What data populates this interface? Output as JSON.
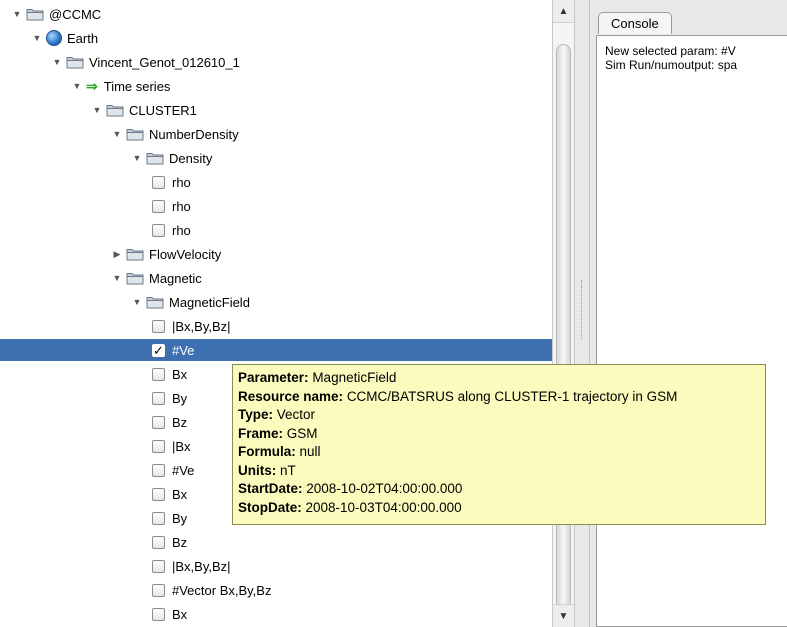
{
  "tree": {
    "rows": [
      {
        "label": "@CCMC",
        "indent": 0,
        "toggle": "expanded",
        "icon": "folder-icon"
      },
      {
        "label": "Earth",
        "indent": 1,
        "toggle": "expanded",
        "icon": "globe-icon"
      },
      {
        "label": "Vincent_Genot_012610_1",
        "indent": 2,
        "toggle": "expanded",
        "icon": "folder-icon"
      },
      {
        "label": "Time series",
        "indent": 3,
        "toggle": "expanded",
        "icon": "arrow-right-icon"
      },
      {
        "label": "CLUSTER1",
        "indent": 4,
        "toggle": "expanded",
        "icon": "folder-icon"
      },
      {
        "label": "NumberDensity",
        "indent": 5,
        "toggle": "expanded",
        "icon": "folder-icon"
      },
      {
        "label": "Density",
        "indent": 6,
        "toggle": "expanded",
        "icon": "folder-icon"
      },
      {
        "label": "rho",
        "indent": 7,
        "icon": "checkbox",
        "checked": false
      },
      {
        "label": "rho",
        "indent": 7,
        "icon": "checkbox",
        "checked": false
      },
      {
        "label": "rho",
        "indent": 7,
        "icon": "checkbox",
        "checked": false
      },
      {
        "label": "FlowVelocity",
        "indent": 5,
        "toggle": "collapsed",
        "icon": "folder-icon"
      },
      {
        "label": "Magnetic",
        "indent": 5,
        "toggle": "expanded",
        "icon": "folder-icon"
      },
      {
        "label": "MagneticField",
        "indent": 6,
        "toggle": "expanded",
        "icon": "folder-icon"
      },
      {
        "label": "|Bx,By,Bz|",
        "indent": 7,
        "icon": "checkbox",
        "checked": false
      },
      {
        "label": "#Ve",
        "indent": 7,
        "icon": "checkbox",
        "checked": true,
        "selected": true
      },
      {
        "label": "Bx",
        "indent": 7,
        "icon": "checkbox",
        "checked": false
      },
      {
        "label": "By",
        "indent": 7,
        "icon": "checkbox",
        "checked": false
      },
      {
        "label": "Bz",
        "indent": 7,
        "icon": "checkbox",
        "checked": false
      },
      {
        "label": "|Bx",
        "indent": 7,
        "icon": "checkbox",
        "checked": false
      },
      {
        "label": "#Ve",
        "indent": 7,
        "icon": "checkbox",
        "checked": false
      },
      {
        "label": "Bx",
        "indent": 7,
        "icon": "checkbox",
        "checked": false
      },
      {
        "label": "By",
        "indent": 7,
        "icon": "checkbox",
        "checked": false
      },
      {
        "label": "Bz",
        "indent": 7,
        "icon": "checkbox",
        "checked": false
      },
      {
        "label": "|Bx,By,Bz|",
        "indent": 7,
        "icon": "checkbox",
        "checked": false
      },
      {
        "label": "#Vector Bx,By,Bz",
        "indent": 7,
        "icon": "checkbox",
        "checked": false
      },
      {
        "label": "Bx",
        "indent": 7,
        "icon": "checkbox",
        "checked": false
      }
    ]
  },
  "console": {
    "tab_label": "Console",
    "lines": [
      "New selected param: #V",
      "Sim Run/numoutput: spa"
    ]
  },
  "tooltip": {
    "lines": [
      {
        "key": "Parameter:",
        "value": "MagneticField"
      },
      {
        "key": "Resource name:",
        "value": "CCMC/BATSRUS along CLUSTER-1 trajectory in GSM"
      },
      {
        "key": "Type:",
        "value": "Vector"
      },
      {
        "key": "Frame:",
        "value": "GSM"
      },
      {
        "key": "Formula:",
        "value": "null"
      },
      {
        "key": "Units:",
        "value": "nT"
      },
      {
        "key": "StartDate:",
        "value": "2008-10-02T04:00:00.000"
      },
      {
        "key": "StopDate:",
        "value": "2008-10-03T04:00:00.000"
      }
    ]
  },
  "scrollbar": {
    "up_glyph": "▲",
    "down_glyph": "▼"
  },
  "colors": {
    "selection": "#3e6fb0",
    "tooltip_bg": "#fbfbbd",
    "folder": "#b9c3cf"
  }
}
